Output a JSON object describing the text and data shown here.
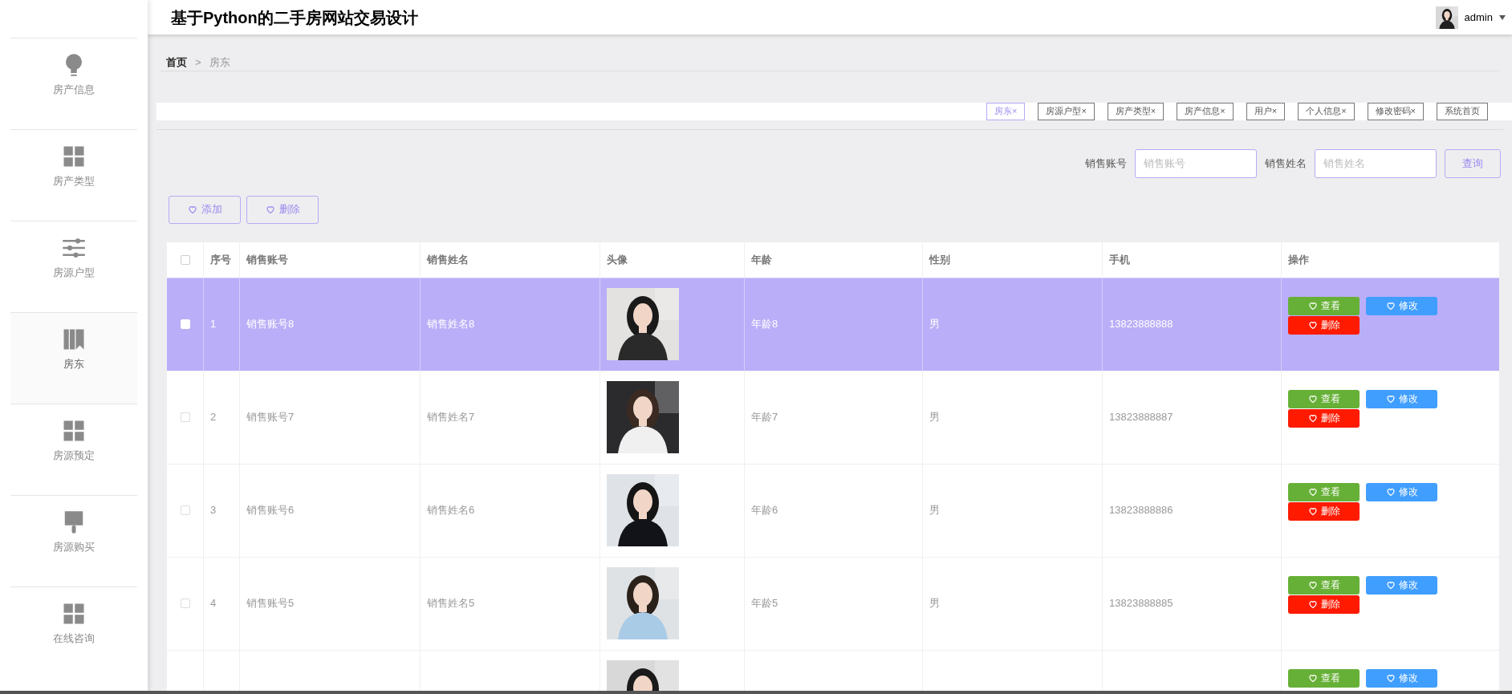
{
  "header": {
    "title": "基于Python的二手房网站交易设计",
    "user": "admin"
  },
  "sidebar": {
    "items": [
      {
        "label": "房产信息",
        "kind": "bulb",
        "selected": false
      },
      {
        "label": "房产类型",
        "kind": "grid",
        "selected": false
      },
      {
        "label": "房源户型",
        "kind": "sliders",
        "selected": false
      },
      {
        "label": "房东",
        "kind": "books",
        "selected": true
      },
      {
        "label": "房源预定",
        "kind": "grid",
        "selected": false
      },
      {
        "label": "房源购买",
        "kind": "brush",
        "selected": false
      },
      {
        "label": "在线咨询",
        "kind": "grid",
        "selected": false
      }
    ]
  },
  "breadcrumb": [
    "首页",
    ">",
    "房东"
  ],
  "tabs": [
    {
      "label": "房东",
      "close": "×",
      "selected": true
    },
    {
      "label": "房源户型",
      "close": "×",
      "selected": false
    },
    {
      "label": "房产类型",
      "close": "×",
      "selected": false
    },
    {
      "label": "房产信息",
      "close": "×",
      "selected": false
    },
    {
      "label": "用户",
      "close": "×",
      "selected": false
    },
    {
      "label": "个人信息",
      "close": "×",
      "selected": false
    },
    {
      "label": "修改密码",
      "close": "×",
      "selected": false
    },
    {
      "label": "系统首页",
      "selected": false
    }
  ],
  "search": {
    "fields": [
      {
        "label": "销售账号",
        "placeholder": "销售账号"
      },
      {
        "label": "销售姓名",
        "placeholder": "销售姓名"
      }
    ],
    "button": "查询"
  },
  "actions": [
    "添加",
    "删除"
  ],
  "table": {
    "header_checked": false,
    "columns": [
      "序号",
      "销售账号",
      "销售姓名",
      "头像",
      "年龄",
      "性别",
      "手机",
      "操作"
    ],
    "rows": [
      {
        "selected": true,
        "checked": false,
        "cells": [
          "1",
          "销售账号8",
          "销售姓名8",
          "年龄8",
          "男",
          "13823888888"
        ],
        "buttons": [
          "查看",
          "修改",
          "删除"
        ]
      },
      {
        "selected": false,
        "checked": false,
        "cells": [
          "2",
          "销售账号7",
          "销售姓名7",
          "年龄7",
          "男",
          "13823888887"
        ],
        "buttons": [
          "查看",
          "修改",
          "删除"
        ]
      },
      {
        "selected": false,
        "checked": false,
        "cells": [
          "3",
          "销售账号6",
          "销售姓名6",
          "年龄6",
          "男",
          "13823888886"
        ],
        "buttons": [
          "查看",
          "修改",
          "删除"
        ]
      },
      {
        "selected": false,
        "checked": false,
        "cells": [
          "4",
          "销售账号5",
          "销售姓名5",
          "年龄5",
          "男",
          "13823888885"
        ],
        "buttons": [
          "查看",
          "修改",
          "删除"
        ]
      },
      {
        "selected": false,
        "buttons": [
          "查看",
          "修改"
        ]
      }
    ]
  }
}
